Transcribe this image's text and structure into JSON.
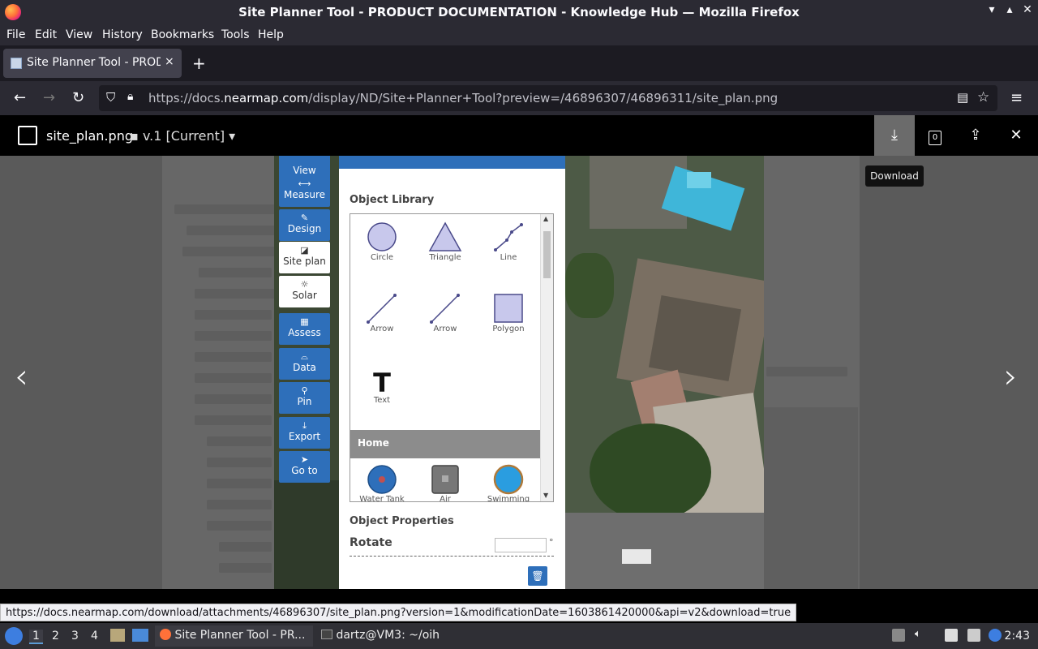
{
  "window": {
    "title": "Site Planner Tool - PRODUCT DOCUMENTATION - Knowledge Hub — Mozilla Firefox"
  },
  "menu": [
    "File",
    "Edit",
    "View",
    "History",
    "Bookmarks",
    "Tools",
    "Help"
  ],
  "tab": {
    "label": "Site Planner Tool - PRODUCT DOCUMENTATION",
    "close": "×",
    "new": "+"
  },
  "url": {
    "prefix": "https://docs.",
    "domain": "nearmap.com",
    "path": "/display/ND/Site+Planner+Tool?preview=/46896307/46896311/site_plan.png"
  },
  "viewer": {
    "filename": "site_plan.png",
    "version": "v.1 [Current]",
    "comment_count": "0",
    "tooltip": "Download"
  },
  "toolbar": [
    {
      "label": "View",
      "icon": "eye-icon",
      "active": false
    },
    {
      "label": "Measure",
      "icon": "measure-icon",
      "active": false
    },
    {
      "label": "Design",
      "icon": "pencil-icon",
      "active": false
    },
    {
      "label": "Site plan",
      "icon": "siteplan-icon",
      "active": true
    },
    {
      "label": "Solar",
      "icon": "sun-icon",
      "active": true
    },
    {
      "label": "Assess",
      "icon": "grid-icon",
      "active": false
    },
    {
      "label": "Data",
      "icon": "inbox-icon",
      "active": false
    },
    {
      "label": "Pin",
      "icon": "pin-icon",
      "active": false
    },
    {
      "label": "Export",
      "icon": "download-icon",
      "active": false
    },
    {
      "label": "Go to",
      "icon": "navigate-icon",
      "active": false
    }
  ],
  "panel": {
    "title": "Site plan",
    "library_title": "Object Library",
    "objects": [
      "Circle",
      "Triangle",
      "Line",
      "Arrow",
      "Arrow",
      "Polygon",
      "Text"
    ],
    "section": "Home",
    "home_objects": [
      "Water Tank",
      "Air",
      "Swimming"
    ],
    "properties_title": "Object Properties",
    "rotate_label": "Rotate",
    "rotate_unit": "°"
  },
  "status_link": "https://docs.nearmap.com/download/attachments/46896307/site_plan.png?version=1&modificationDate=1603861420000&api=v2&download=true",
  "taskbar": {
    "workspaces": [
      "1",
      "2",
      "3",
      "4"
    ],
    "tasks": [
      "Site Planner Tool - PR...",
      "dartz@VM3: ~/oih"
    ],
    "clock": "2:43"
  },
  "colors": {
    "accent": "#2e6fba",
    "chrome": "#2b2a33"
  }
}
